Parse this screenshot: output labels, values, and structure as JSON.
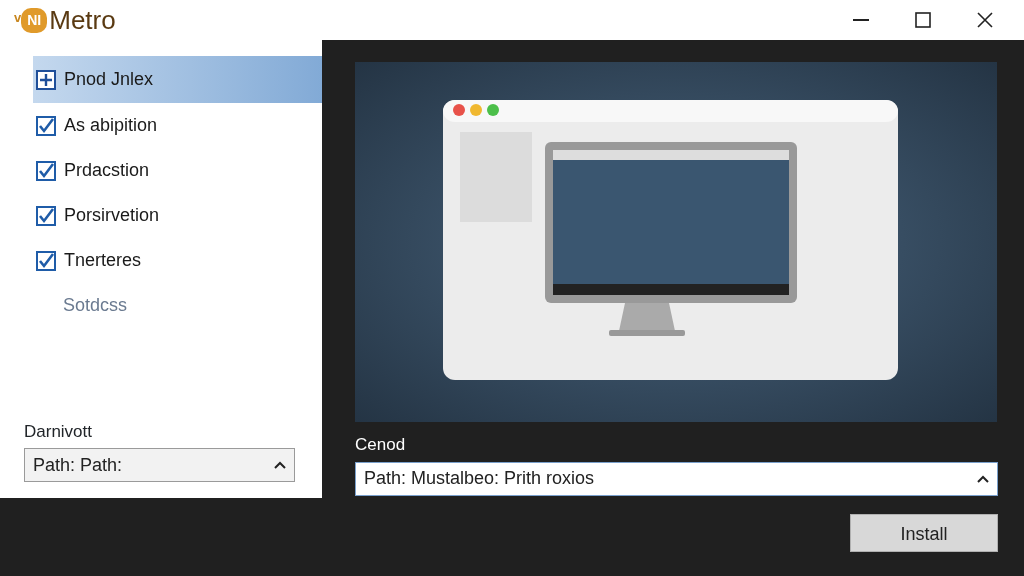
{
  "window": {
    "logo_mark": "v",
    "logo_badge": "NI",
    "logo_text": "Metro"
  },
  "sidebar": {
    "items": [
      {
        "kind": "expand",
        "label": "Pnod Jnlex",
        "selected": true,
        "disabled": false
      },
      {
        "kind": "checkbox",
        "label": "As abipition",
        "selected": false,
        "checked": true,
        "disabled": false
      },
      {
        "kind": "checkbox",
        "label": "Prdacstion",
        "selected": false,
        "checked": true,
        "disabled": false
      },
      {
        "kind": "checkbox",
        "label": "Porsirvetion",
        "selected": false,
        "checked": true,
        "disabled": false
      },
      {
        "kind": "checkbox",
        "label": "Tnerteres",
        "selected": false,
        "checked": true,
        "disabled": false
      },
      {
        "kind": "plain",
        "label": "Sotdcss",
        "selected": false,
        "disabled": true
      }
    ]
  },
  "left_field": {
    "label": "Darnivott",
    "value": "Path: Path:"
  },
  "right_field": {
    "label": "Cenod",
    "value": "Path: Mustalbeo: Prith roxios"
  },
  "install_button": "Install"
}
